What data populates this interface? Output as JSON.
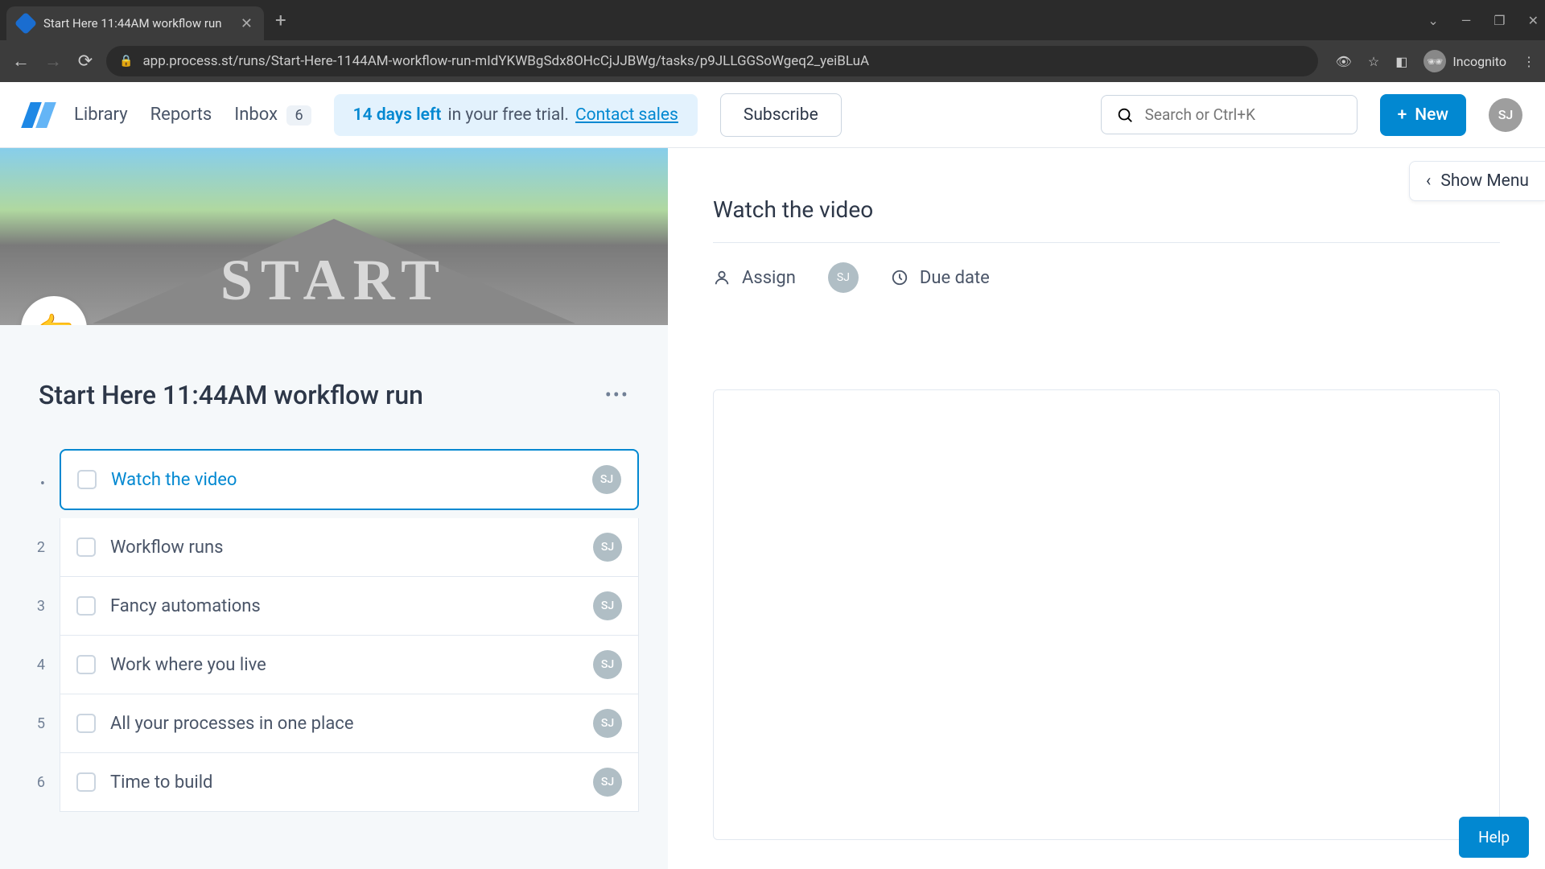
{
  "browser": {
    "tab_title": "Start Here 11:44AM workflow run",
    "url": "app.process.st/runs/Start-Here-1144AM-workflow-run-mIdYKWBgSdx8OHcCjJJBWg/tasks/p9JLLGGSoWgeq2_yeiBLuA",
    "incognito_label": "Incognito"
  },
  "nav": {
    "library": "Library",
    "reports": "Reports",
    "inbox": "Inbox",
    "inbox_count": "6"
  },
  "trial": {
    "days": "14 days left",
    "rest": " in your free trial.",
    "contact": "Contact sales"
  },
  "subscribe_label": "Subscribe",
  "search_placeholder": "Search or Ctrl+K",
  "new_label": "New",
  "user_initials": "SJ",
  "hero_text": "START",
  "hero_emoji": "👉",
  "run_title": "Start Here 11:44AM workflow run",
  "tasks": [
    {
      "num": "",
      "label": "Watch the video",
      "assignee": "SJ",
      "active": true
    },
    {
      "num": "2",
      "label": "Workflow runs",
      "assignee": "SJ",
      "active": false
    },
    {
      "num": "3",
      "label": "Fancy automations",
      "assignee": "SJ",
      "active": false
    },
    {
      "num": "4",
      "label": "Work where you live",
      "assignee": "SJ",
      "active": false
    },
    {
      "num": "5",
      "label": "All your processes in one place",
      "assignee": "SJ",
      "active": false
    },
    {
      "num": "6",
      "label": "Time to build",
      "assignee": "SJ",
      "active": false
    }
  ],
  "detail": {
    "title": "Watch the video",
    "assign_label": "Assign",
    "assignee": "SJ",
    "due_label": "Due date"
  },
  "show_menu_label": "Show Menu",
  "help_label": "Help"
}
